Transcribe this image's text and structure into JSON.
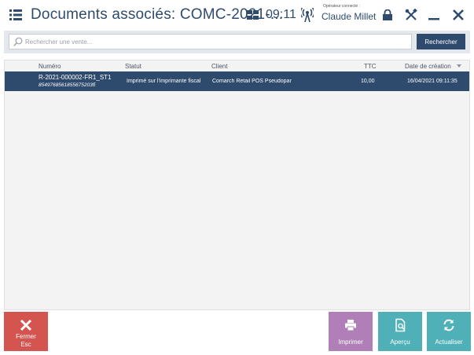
{
  "header": {
    "title": "Documents associés: COMC-2021-...",
    "time": "09:11",
    "operator_label": "Opérateur connecté :",
    "operator_name": "Claude Millet"
  },
  "search": {
    "placeholder": "Rechercher une vente...",
    "value": "",
    "button_label": "Rechercher"
  },
  "grid": {
    "columns": {
      "numero": "Numéro",
      "statut": "Statut",
      "client": "Client",
      "ttc": "TTC",
      "date": "Date de création"
    },
    "rows": [
      {
        "numero": "R-2021-000002-FR1_ST1",
        "code": "8549768561855675203б",
        "statut": "Imprimé sur l'imprimante fiscal",
        "client": "Comarch Retail POS Pseudopar",
        "ttc": "10,00",
        "date": "16/04/2021 09:11:35"
      }
    ]
  },
  "buttons": {
    "fermer": "Fermer",
    "fermer_shortcut": "Esc",
    "imprimer": "Imprimer",
    "apercu": "Aperçu",
    "actualiser": "Actualiser"
  },
  "colors": {
    "primary": "#2e4a6d",
    "close_button": "#d4544f",
    "print_button": "#b07fb8",
    "teal_button": "#4fb0b8"
  },
  "icons": [
    "menu-icon",
    "layout-icon",
    "antenna-icon",
    "lock-icon",
    "tools-icon",
    "minimize-icon",
    "close-icon",
    "search-icon",
    "sort-desc-icon",
    "x-icon",
    "printer-icon",
    "preview-icon",
    "refresh-icon"
  ]
}
